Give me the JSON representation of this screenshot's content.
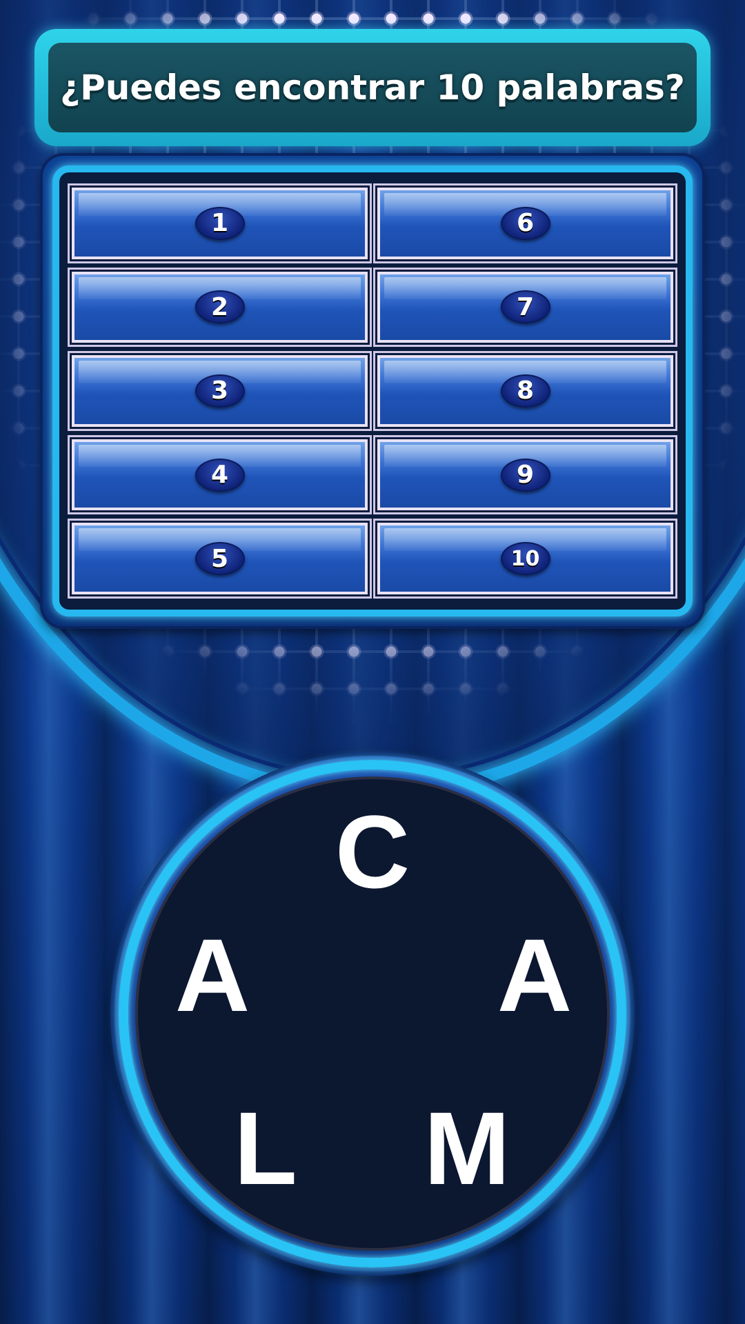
{
  "header": {
    "prompt": "¿Puedes encontrar 10 palabras?"
  },
  "board": {
    "slots": [
      {
        "number": "1",
        "answer": ""
      },
      {
        "number": "6",
        "answer": ""
      },
      {
        "number": "2",
        "answer": ""
      },
      {
        "number": "7",
        "answer": ""
      },
      {
        "number": "3",
        "answer": ""
      },
      {
        "number": "8",
        "answer": ""
      },
      {
        "number": "4",
        "answer": ""
      },
      {
        "number": "9",
        "answer": ""
      },
      {
        "number": "5",
        "answer": ""
      },
      {
        "number": "10",
        "answer": ""
      }
    ]
  },
  "wheel": {
    "letters": [
      "C",
      "A",
      "A",
      "L",
      "M"
    ]
  },
  "colors": {
    "accent_ring": "#29c3f5",
    "title_frame": "#2fd3ea",
    "tile_blue": "#1f54b8",
    "wheel_core": "#0c1730"
  }
}
